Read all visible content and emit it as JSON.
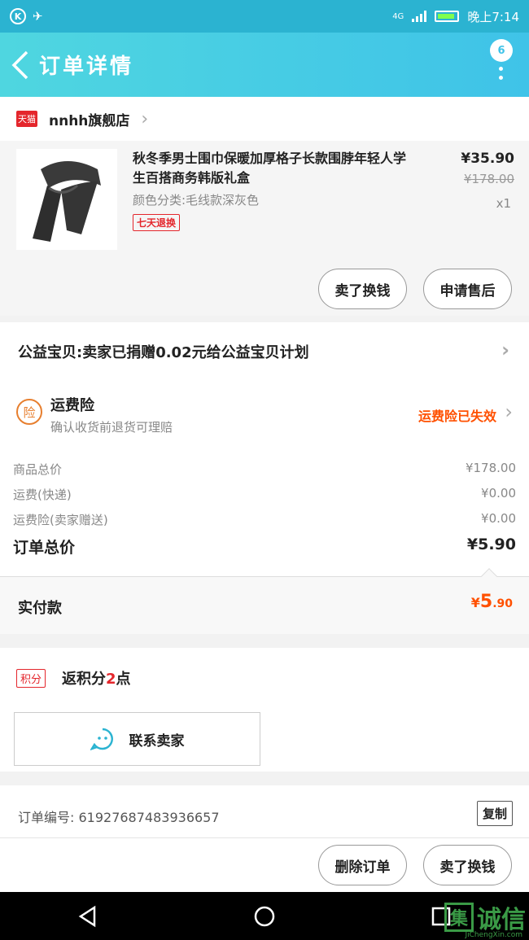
{
  "status_bar": {
    "network": "4G",
    "time": "晚上7:14"
  },
  "header": {
    "title": "订单详情",
    "badge_count": "6"
  },
  "shop": {
    "name": "nnhh旗舰店",
    "platform": "天猫"
  },
  "product": {
    "title": "秋冬季男士围巾保暖加厚格子长款围脖年轻人学生百搭商务韩版礼盒",
    "spec": "颜色分类:毛线款深灰色",
    "tag": "七天退换",
    "price": "¥35.90",
    "original_price": "¥178.00",
    "quantity": "x1",
    "buttons": {
      "refund": "卖了换钱",
      "after_sale": "申请售后"
    }
  },
  "charity": {
    "text": "公益宝贝:卖家已捐赠0.02元给公益宝贝计划"
  },
  "insurance": {
    "icon_text": "险",
    "title": "运费险",
    "subtitle": "确认收货前退货可理赔",
    "status": "运费险已失效"
  },
  "costs": [
    {
      "label": "商品总价",
      "value": "¥178.00"
    },
    {
      "label": "运费(快递)",
      "value": "¥0.00"
    },
    {
      "label": "运费险(卖家赠送)",
      "value": "¥0.00"
    }
  ],
  "order_total": {
    "label": "订单总价",
    "value": "¥5.90"
  },
  "paid": {
    "label": "实付款",
    "currency": "¥",
    "integer": "5",
    "decimal": ".90"
  },
  "points": {
    "badge": "积分",
    "prefix": "返积分",
    "count": "2",
    "suffix": "点"
  },
  "contact": {
    "label": "联系卖家"
  },
  "order_info": {
    "order_no": "订单编号: 61927687483936657",
    "copy": "复制"
  },
  "bottom_bar": {
    "delete": "删除订单",
    "resell": "卖了换钱"
  },
  "watermark": {
    "text": "诚信",
    "box": "集",
    "sub": "JiChengXin.com"
  },
  "colors": {
    "header": "#3fc3e8",
    "accent": "#ff5000",
    "tmall": "#e4262c"
  }
}
